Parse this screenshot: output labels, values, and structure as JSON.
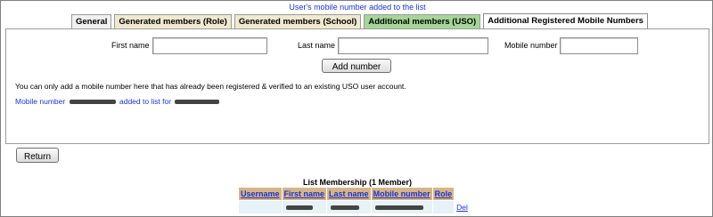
{
  "status_message": "User's mobile number added to the list",
  "tabs": [
    {
      "label": "General"
    },
    {
      "label": "Generated members (Role)"
    },
    {
      "label": "Generated members (School)"
    },
    {
      "label": "Additional members (USO)"
    },
    {
      "label": "Additional Registered Mobile Numbers"
    }
  ],
  "form": {
    "first_name_label": "First name",
    "last_name_label": "Last name",
    "mobile_label": "Mobile number",
    "first_name_value": "",
    "last_name_value": "",
    "mobile_value": "",
    "add_button": "Add number"
  },
  "note": "You can only add a mobile number here that has already been registered & verified to an existing USO user account.",
  "success": {
    "prefix": "Mobile number",
    "middle": "added to list for"
  },
  "return_button": "Return",
  "membership": {
    "title": "List Membership (1 Member)",
    "columns": [
      "Username",
      "First name",
      "Last name",
      "Mobile number",
      "Role"
    ],
    "rows": [
      {
        "username": "",
        "first_name": "",
        "last_name": "",
        "mobile": "",
        "role": "",
        "action": "Del"
      }
    ]
  },
  "colors": {
    "link_blue": "#1b35c8",
    "tab_tan": "#efe9d0",
    "tab_green": "#a5d699",
    "header_tan": "#d6b48a",
    "row_blue": "#e6f2f5"
  }
}
